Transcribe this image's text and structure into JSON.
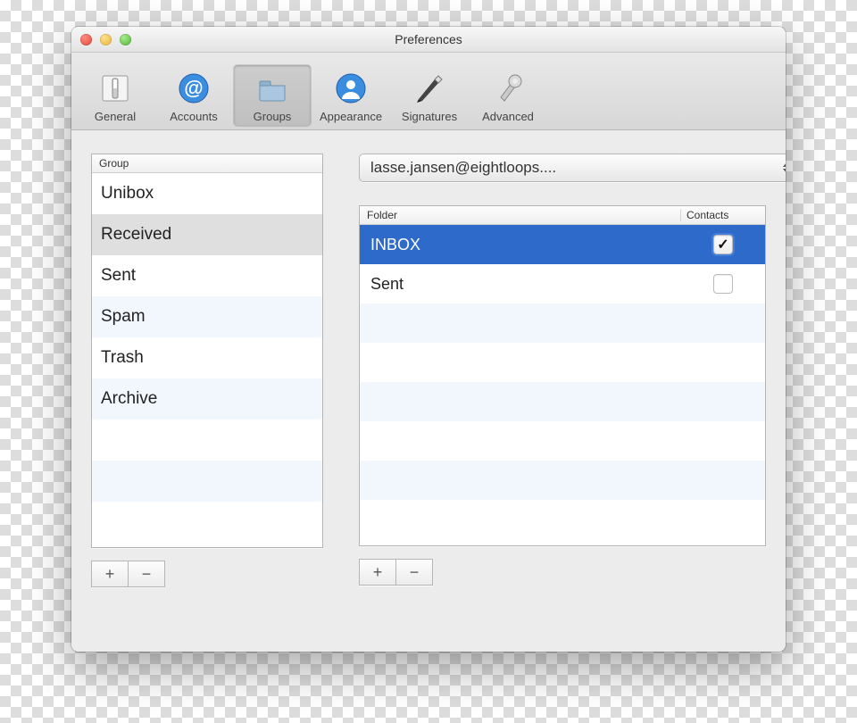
{
  "window": {
    "title": "Preferences"
  },
  "toolbar": {
    "items": [
      {
        "label": "General",
        "icon": "general-icon",
        "selected": false
      },
      {
        "label": "Accounts",
        "icon": "accounts-icon",
        "selected": false
      },
      {
        "label": "Groups",
        "icon": "groups-icon",
        "selected": true
      },
      {
        "label": "Appearance",
        "icon": "appearance-icon",
        "selected": false
      },
      {
        "label": "Signatures",
        "icon": "signatures-icon",
        "selected": false
      },
      {
        "label": "Advanced",
        "icon": "advanced-icon",
        "selected": false
      }
    ]
  },
  "groups": {
    "header": "Group",
    "items": [
      {
        "name": "Unibox",
        "selected": false
      },
      {
        "name": "Received",
        "selected": true
      },
      {
        "name": "Sent",
        "selected": false
      },
      {
        "name": "Spam",
        "selected": false
      },
      {
        "name": "Trash",
        "selected": false
      },
      {
        "name": "Archive",
        "selected": false
      }
    ],
    "add_label": "+",
    "remove_label": "−"
  },
  "account_select": {
    "value": "lasse.jansen@eightloops...."
  },
  "folders": {
    "header_folder": "Folder",
    "header_contacts": "Contacts",
    "rows": [
      {
        "name": "INBOX",
        "contacts_checked": true,
        "selected": true
      },
      {
        "name": "Sent",
        "contacts_checked": false,
        "selected": false
      }
    ],
    "add_label": "+",
    "remove_label": "−"
  }
}
